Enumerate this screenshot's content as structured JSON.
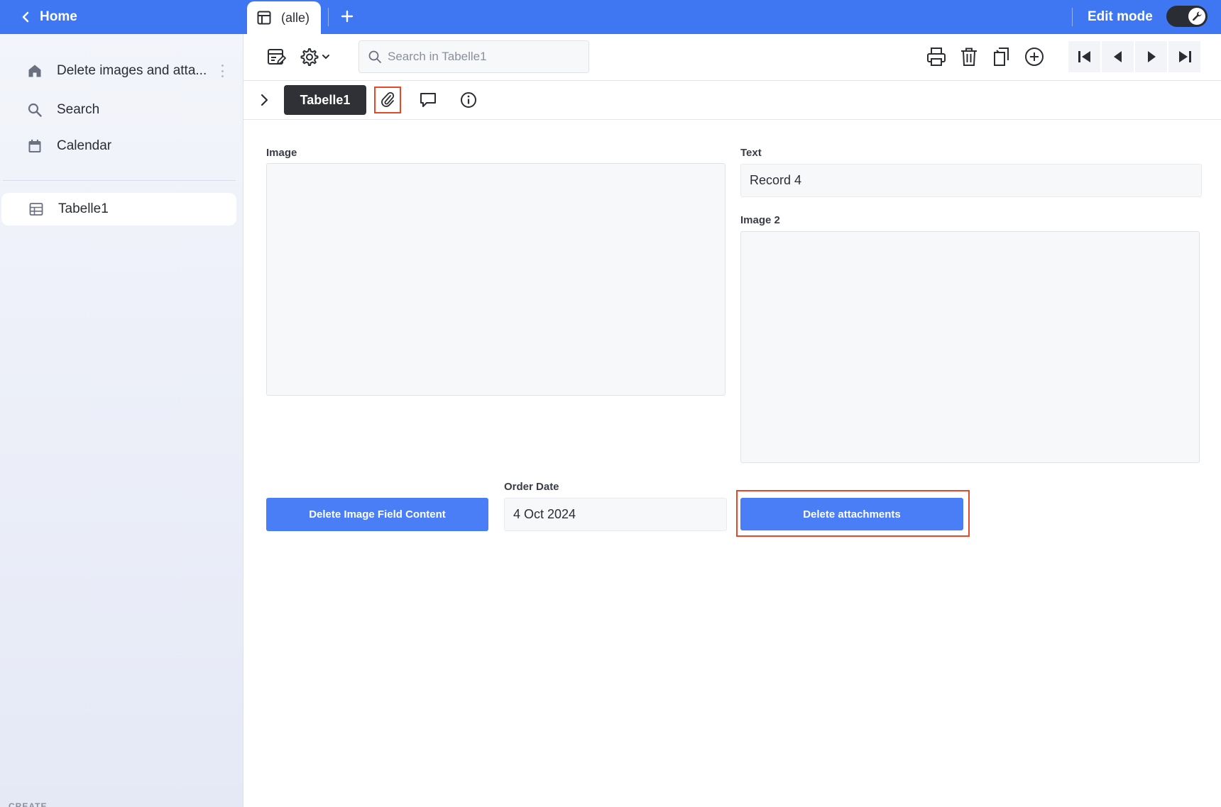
{
  "topbar": {
    "home_label": "Home",
    "tab_label": "(alle)",
    "edit_mode_label": "Edit mode",
    "edit_mode_on": true
  },
  "sidebar": {
    "app_name": "Delete images and atta...",
    "items": [
      {
        "label": "Search",
        "icon": "search-icon"
      },
      {
        "label": "Calendar",
        "icon": "calendar-icon"
      }
    ],
    "tables": [
      {
        "label": "Tabelle1",
        "icon": "table-icon",
        "active": true
      }
    ],
    "create_section": "CREATE"
  },
  "toolbar": {
    "search_placeholder": "Search in Tabelle1",
    "icons": [
      "edit-layout-icon",
      "settings-icon",
      "print-icon",
      "delete-icon",
      "duplicate-icon",
      "add-icon",
      "first-record-icon",
      "previous-record-icon",
      "next-record-icon",
      "last-record-icon"
    ]
  },
  "subbar": {
    "table_name": "Tabelle1",
    "icons": [
      "paperclip-icon",
      "comment-icon",
      "info-icon"
    ]
  },
  "form": {
    "image_label": "Image",
    "text_label": "Text",
    "text_value": "Record 4",
    "image2_label": "Image 2",
    "order_date_label": "Order Date",
    "order_date_value": "4 Oct 2024",
    "delete_image_button": "Delete Image Field Content",
    "delete_attachments_button": "Delete attachments"
  },
  "colors": {
    "topbar": "#3f77f2",
    "primary_button": "#4a7ef6",
    "highlight": "#e8472a",
    "dark_pill": "#2f3137"
  }
}
